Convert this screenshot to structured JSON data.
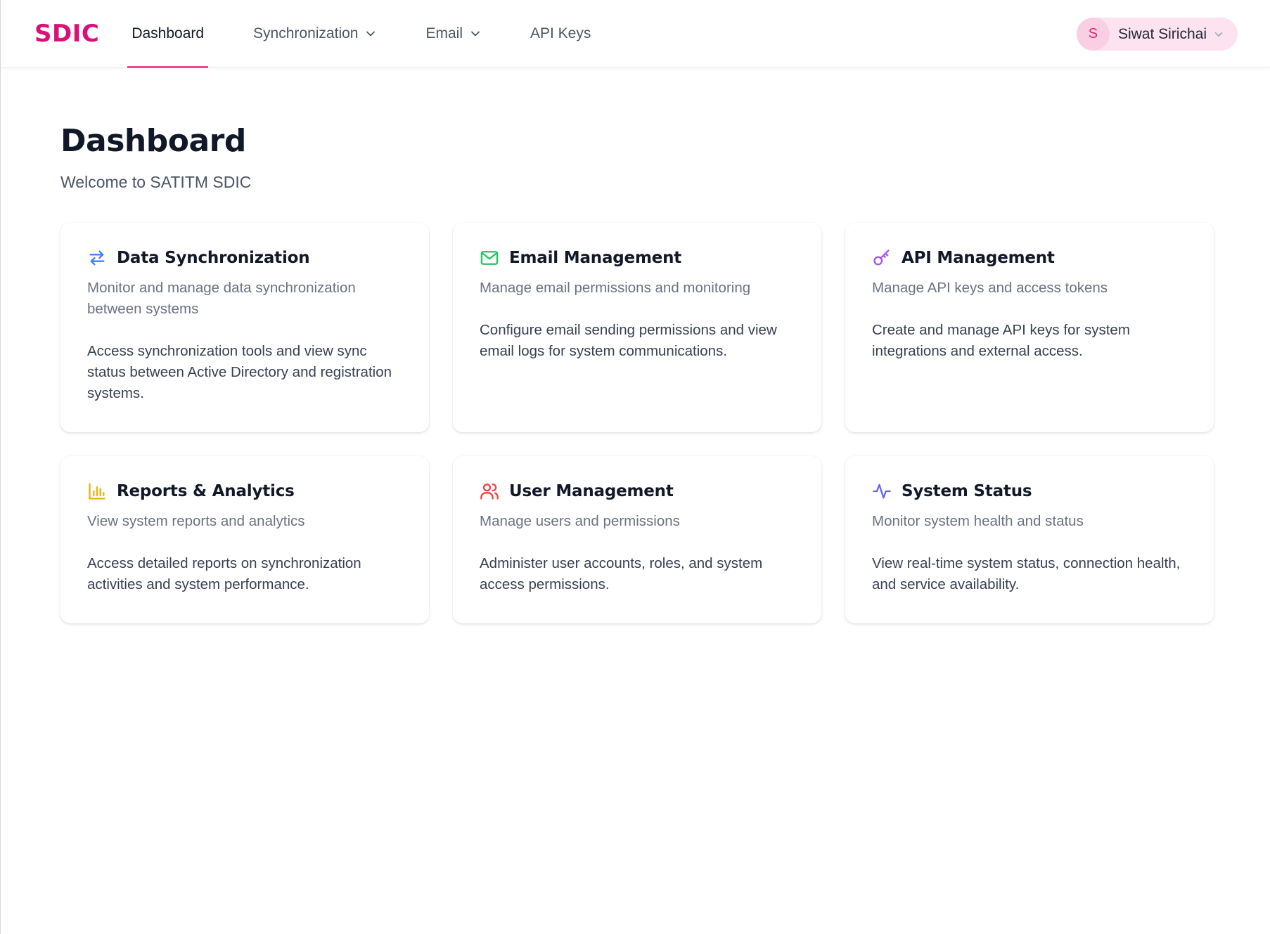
{
  "header": {
    "logo": "SDIC",
    "nav": [
      {
        "label": "Dashboard",
        "active": true,
        "dropdown": false
      },
      {
        "label": "Synchronization",
        "active": false,
        "dropdown": true
      },
      {
        "label": "Email",
        "active": false,
        "dropdown": true
      },
      {
        "label": "API Keys",
        "active": false,
        "dropdown": false
      }
    ],
    "user": {
      "initial": "S",
      "name": "Siwat Sirichai"
    }
  },
  "page": {
    "title": "Dashboard",
    "subtitle": "Welcome to SATITM SDIC"
  },
  "cards": [
    {
      "icon": "arrows-exchange-icon",
      "icon_color": "#3b82f6",
      "title": "Data Synchronization",
      "description": "Monitor and manage data synchronization between systems",
      "body": "Access synchronization tools and view sync status between Active Directory and registration systems."
    },
    {
      "icon": "mail-icon",
      "icon_color": "#22c55e",
      "title": "Email Management",
      "description": "Manage email permissions and monitoring",
      "body": "Configure email sending permissions and view email logs for system communications."
    },
    {
      "icon": "key-icon",
      "icon_color": "#a855f7",
      "title": "API Management",
      "description": "Manage API keys and access tokens",
      "body": "Create and manage API keys for system integrations and external access."
    },
    {
      "icon": "bar-chart-icon",
      "icon_color": "#eab308",
      "title": "Reports & Analytics",
      "description": "View system reports and analytics",
      "body": "Access detailed reports on synchronization activities and system performance."
    },
    {
      "icon": "users-icon",
      "icon_color": "#ef4444",
      "title": "User Management",
      "description": "Manage users and permissions",
      "body": "Administer user accounts, roles, and system access permissions."
    },
    {
      "icon": "activity-icon",
      "icon_color": "#6366f1",
      "title": "System Status",
      "description": "Monitor system health and status",
      "body": "View real-time system status, connection health, and service availability."
    }
  ]
}
